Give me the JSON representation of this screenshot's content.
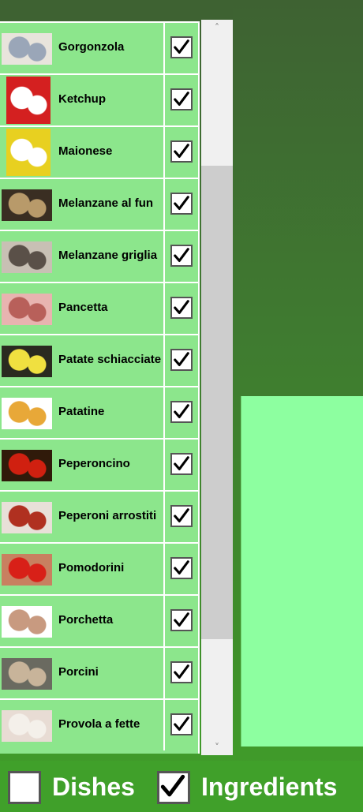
{
  "ingredients": [
    {
      "name": "Gorgonzola",
      "checked": true,
      "photo": "gorgonzola-photo",
      "colors": [
        "#e8e4dc",
        "#9aa6b8"
      ]
    },
    {
      "name": "Ketchup",
      "checked": true,
      "photo": "ketchup-photo",
      "colors": [
        "#d42020",
        "#ffffff"
      ]
    },
    {
      "name": "Maionese",
      "checked": true,
      "photo": "maionese-photo",
      "colors": [
        "#e8d020",
        "#ffffff"
      ]
    },
    {
      "name": "Melanzane al fun",
      "checked": true,
      "photo": "melanzane-funghetto-photo",
      "colors": [
        "#3a2e22",
        "#b89a6a"
      ]
    },
    {
      "name": "Melanzane griglia",
      "checked": true,
      "photo": "melanzane-grigliate-photo",
      "colors": [
        "#c8c0b4",
        "#5a5048"
      ]
    },
    {
      "name": "Pancetta",
      "checked": true,
      "photo": "pancetta-photo",
      "colors": [
        "#e8b4b0",
        "#b8605a"
      ]
    },
    {
      "name": "Patate schiacciate",
      "checked": true,
      "photo": "patate-schiacciate-photo",
      "colors": [
        "#2a2a20",
        "#f0e040"
      ]
    },
    {
      "name": "Patatine",
      "checked": true,
      "photo": "patatine-photo",
      "colors": [
        "#ffffff",
        "#e8a838"
      ]
    },
    {
      "name": "Peperoncino",
      "checked": true,
      "photo": "peperoncino-photo",
      "colors": [
        "#301a0a",
        "#d02010"
      ]
    },
    {
      "name": "Peperoni arrostiti",
      "checked": true,
      "photo": "peperoni-arrostiti-photo",
      "colors": [
        "#e8e0d8",
        "#b03020"
      ]
    },
    {
      "name": "Pomodorini",
      "checked": true,
      "photo": "pomodorini-photo",
      "colors": [
        "#c88060",
        "#d82018"
      ]
    },
    {
      "name": "Porchetta",
      "checked": true,
      "photo": "porchetta-photo",
      "colors": [
        "#ffffff",
        "#c89a80"
      ]
    },
    {
      "name": "Porcini",
      "checked": true,
      "photo": "porcini-photo",
      "colors": [
        "#6a6a60",
        "#c8b49a"
      ]
    },
    {
      "name": "Provola a fette",
      "checked": true,
      "photo": "provola-photo",
      "colors": [
        "#e8dcd4",
        "#f4f0ea"
      ]
    }
  ],
  "filters": {
    "dishes_label": "Dishes",
    "dishes_checked": false,
    "ingredients_label": "Ingredients",
    "ingredients_checked": true
  },
  "scrollbar": {
    "up_glyph": "˄",
    "down_glyph": "˅"
  },
  "colors": {
    "row_bg": "#8ce68c",
    "panel_bg": "#8dffa0",
    "bottom_bg": "#40a02a"
  }
}
